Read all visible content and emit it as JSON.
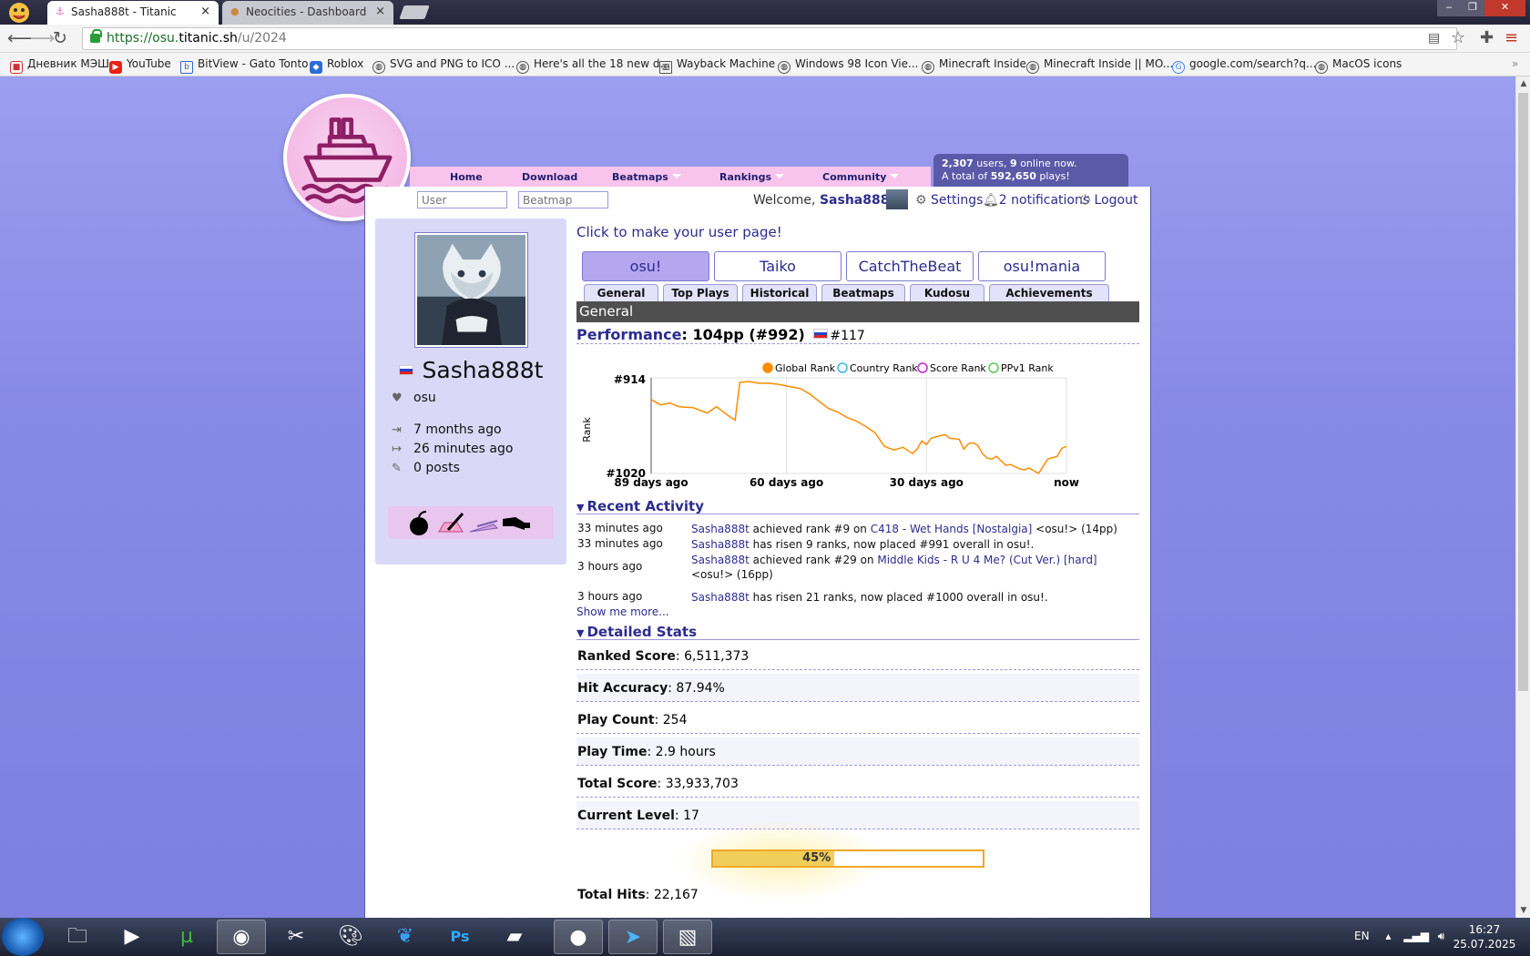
{
  "browser": {
    "tabs": [
      {
        "title": "Sasha888t - Titanic",
        "active": true
      },
      {
        "title": "Neocities - Dashboard",
        "active": false
      }
    ],
    "url_host_prefix": "https://osu.",
    "url_host": "titanic.sh",
    "url_path": "/u/2024",
    "bookmarks": [
      "Дневник МЭШ",
      "YouTube",
      "BitView - Gato Tonto",
      "Roblox",
      "SVG and PNG to ICO ...",
      "Here's all the 18 new d...",
      "Wayback Machine",
      "Windows 98 Icon Vie...",
      "Minecraft Inside",
      "Minecraft Inside || MO...",
      "google.com/search?q...",
      "MacOS icons"
    ]
  },
  "site": {
    "nav": [
      "Home",
      "Download",
      "Beatmaps",
      "Rankings",
      "Community"
    ],
    "online_users": "2,307",
    "users_label": "users,",
    "online_now": "9",
    "online_label": "online now.",
    "total_prefix": "A total of",
    "total_plays": "592,650",
    "plays_label": "plays!",
    "search_user_placeholder": "User",
    "search_beatmap_placeholder": "Beatmap",
    "welcome_prefix": "Welcome,",
    "username": "Sasha888t",
    "settings": "Settings",
    "notifications": "2 notifications",
    "logout": "Logout"
  },
  "profile": {
    "username": "Sasha888t",
    "playstyle": "osu",
    "joined": "7 months ago",
    "last_active": "26 minutes ago",
    "posts": "0 posts"
  },
  "content": {
    "make_page": "Click to make your user page!",
    "modes": [
      "osu!",
      "Taiko",
      "CatchTheBeat",
      "osu!mania"
    ],
    "active_mode": 0,
    "subtabs": [
      "General",
      "Top Plays",
      "Historical",
      "Beatmaps",
      "Kudosu",
      "Achievements"
    ],
    "section_general": "General",
    "performance_label": "Performance",
    "performance_value": ": 104pp (#992)",
    "country_rank": "#117",
    "recent_activity": "Recent Activity",
    "activities": [
      {
        "time": "33 minutes ago",
        "user": "Sasha888t",
        "pre": " achieved rank #9 on ",
        "map": "C418 - Wet Hands [Nostalgia]",
        "post": " <osu!> (14pp)"
      },
      {
        "time": "33 minutes ago",
        "user": "Sasha888t",
        "pre": " has risen 9 ranks, now placed #991 overall in osu!.",
        "map": "",
        "post": ""
      },
      {
        "time": "3 hours ago",
        "user": "Sasha888t",
        "pre": " achieved rank #29 on ",
        "map": "Middle Kids - R U 4 Me? (Cut Ver.) [hard]",
        "post": " <osu!> (16pp)"
      },
      {
        "time": "3 hours ago",
        "user": "Sasha888t",
        "pre": " has risen 21 ranks, now placed #1000 overall in osu!.",
        "map": "",
        "post": ""
      }
    ],
    "show_more": "Show me more...",
    "detailed_stats": "Detailed Stats",
    "stats": [
      {
        "label": "Ranked Score",
        "value": ": 6,511,373"
      },
      {
        "label": "Hit Accuracy",
        "value": ": 87.94%"
      },
      {
        "label": "Play Count",
        "value": ": 254"
      },
      {
        "label": "Play Time",
        "value": ": 2.9 hours"
      },
      {
        "label": "Total Score",
        "value": ": 33,933,703"
      },
      {
        "label": "Current Level",
        "value": ": 17"
      }
    ],
    "level_progress_text": "45%",
    "level_progress": 0.45,
    "total_hits_label": "Total Hits",
    "total_hits_value": ": 22,167"
  },
  "chart_data": {
    "type": "line",
    "ylabel": "Rank",
    "ylim_labels": [
      "#914",
      "#1020"
    ],
    "ylim": [
      914,
      1020
    ],
    "y_inverted": true,
    "x_ticks": [
      "89 days ago",
      "60 days ago",
      "30 days ago",
      "now"
    ],
    "x_tick_days": [
      -89,
      -60,
      -30,
      0
    ],
    "legend": [
      "Global Rank",
      "Country Rank",
      "Score Rank",
      "PPv1 Rank"
    ],
    "legend_colors": [
      "#ff8c00",
      "#38b6e0",
      "#c026d3",
      "#55cc55"
    ],
    "legend_filled": [
      true,
      false,
      false,
      false
    ],
    "legend_position": "top",
    "grid": true,
    "series": [
      {
        "name": "Global Rank",
        "color": "#ff8c00",
        "x": [
          -89,
          -87,
          -85,
          -83,
          -80,
          -77,
          -75,
          -73,
          -71,
          -70,
          -68,
          -66,
          -64,
          -62,
          -61,
          -60,
          -59,
          -58,
          -57,
          -55,
          -53,
          -51,
          -49,
          -47,
          -45,
          -43,
          -41,
          -39,
          -37,
          -35,
          -33,
          -32,
          -31,
          -30,
          -29,
          -27,
          -26,
          -25,
          -23,
          -22,
          -21,
          -20,
          -19,
          -18,
          -17,
          -16,
          -15,
          -13,
          -12,
          -10,
          -9,
          -8,
          -6,
          -4,
          -2,
          -1,
          0
        ],
        "y": [
          938,
          944,
          942,
          946,
          947,
          953,
          946,
          954,
          961,
          919,
          918,
          920,
          920,
          921,
          922,
          923,
          924,
          925,
          926,
          932,
          940,
          948,
          952,
          958,
          962,
          968,
          975,
          990,
          994,
          991,
          998,
          993,
          984,
          988,
          981,
          978,
          977,
          981,
          982,
          993,
          987,
          986,
          989,
          998,
          1003,
          1004,
          1001,
          1011,
          1010,
          1015,
          1016,
          1014,
          1020,
          1004,
          1001,
          992,
          990
        ]
      }
    ]
  },
  "taskbar": {
    "lang": "EN",
    "time": "16:27",
    "date": "25.07.2025"
  }
}
